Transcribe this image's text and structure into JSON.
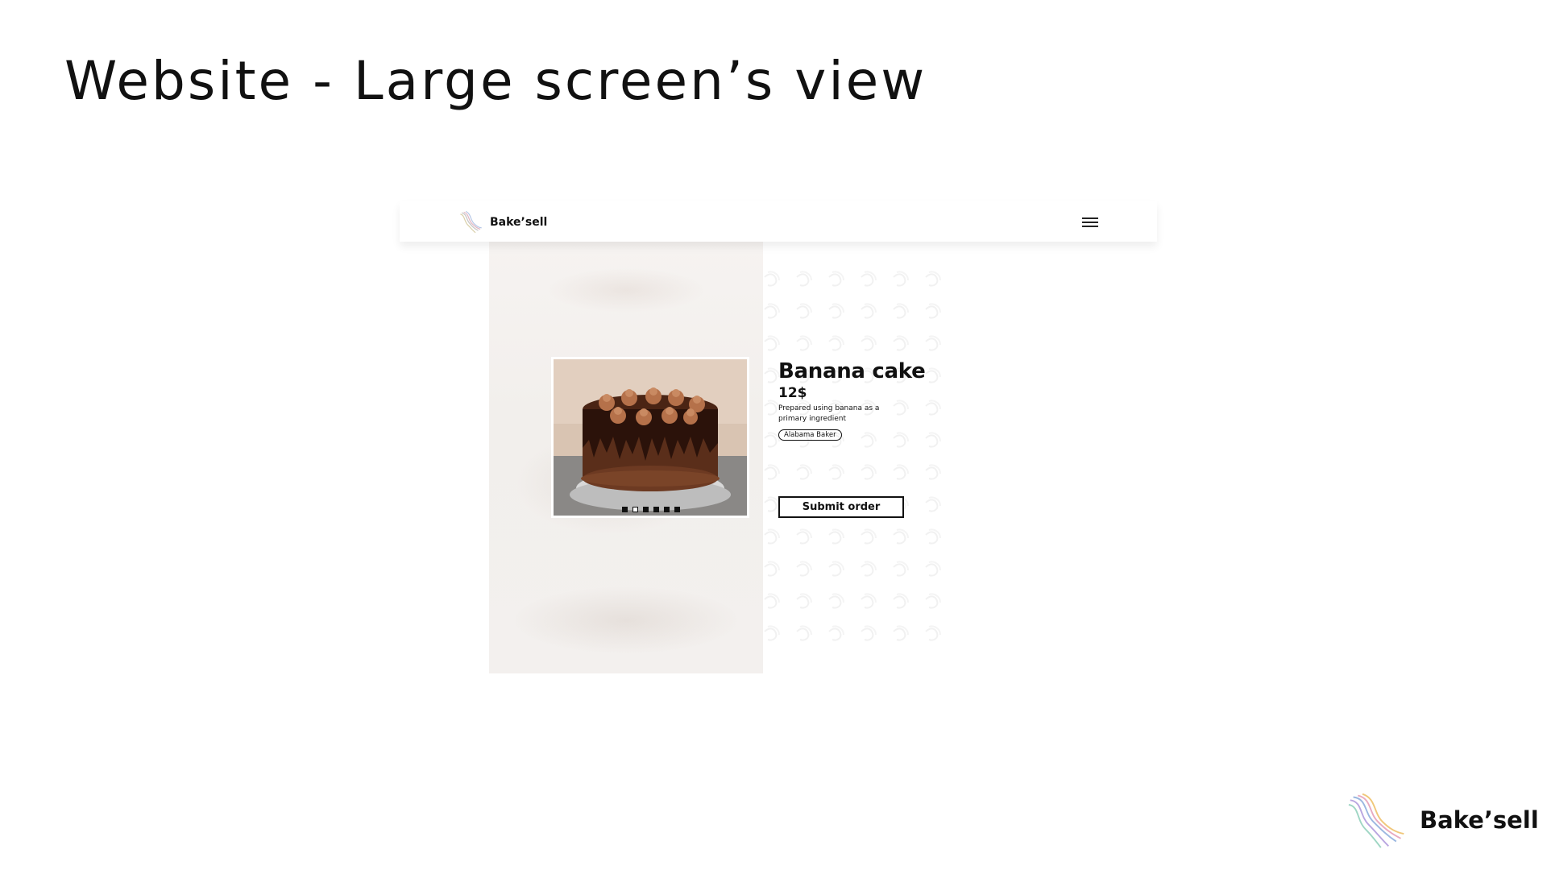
{
  "slide": {
    "title": "Website - Large screen’s view"
  },
  "header": {
    "brand_name": "Bake’sell",
    "logo_icon": "bakesell-wave-logo-icon",
    "menu_icon": "hamburger-menu-icon"
  },
  "product": {
    "name": "Banana cake",
    "price": "12$",
    "description": "Prepared using banana as a primary ingredient",
    "baker": "Alabama Baker",
    "image_alt": "chocolate-drip-cake",
    "carousel_active_index": 1,
    "carousel_count": 6
  },
  "actions": {
    "submit_label": "Submit order"
  },
  "footer": {
    "brand_name": "Bake’sell"
  },
  "colors": {
    "text": "#111111",
    "background": "#ffffff",
    "cake_brown": "#4a2414"
  }
}
